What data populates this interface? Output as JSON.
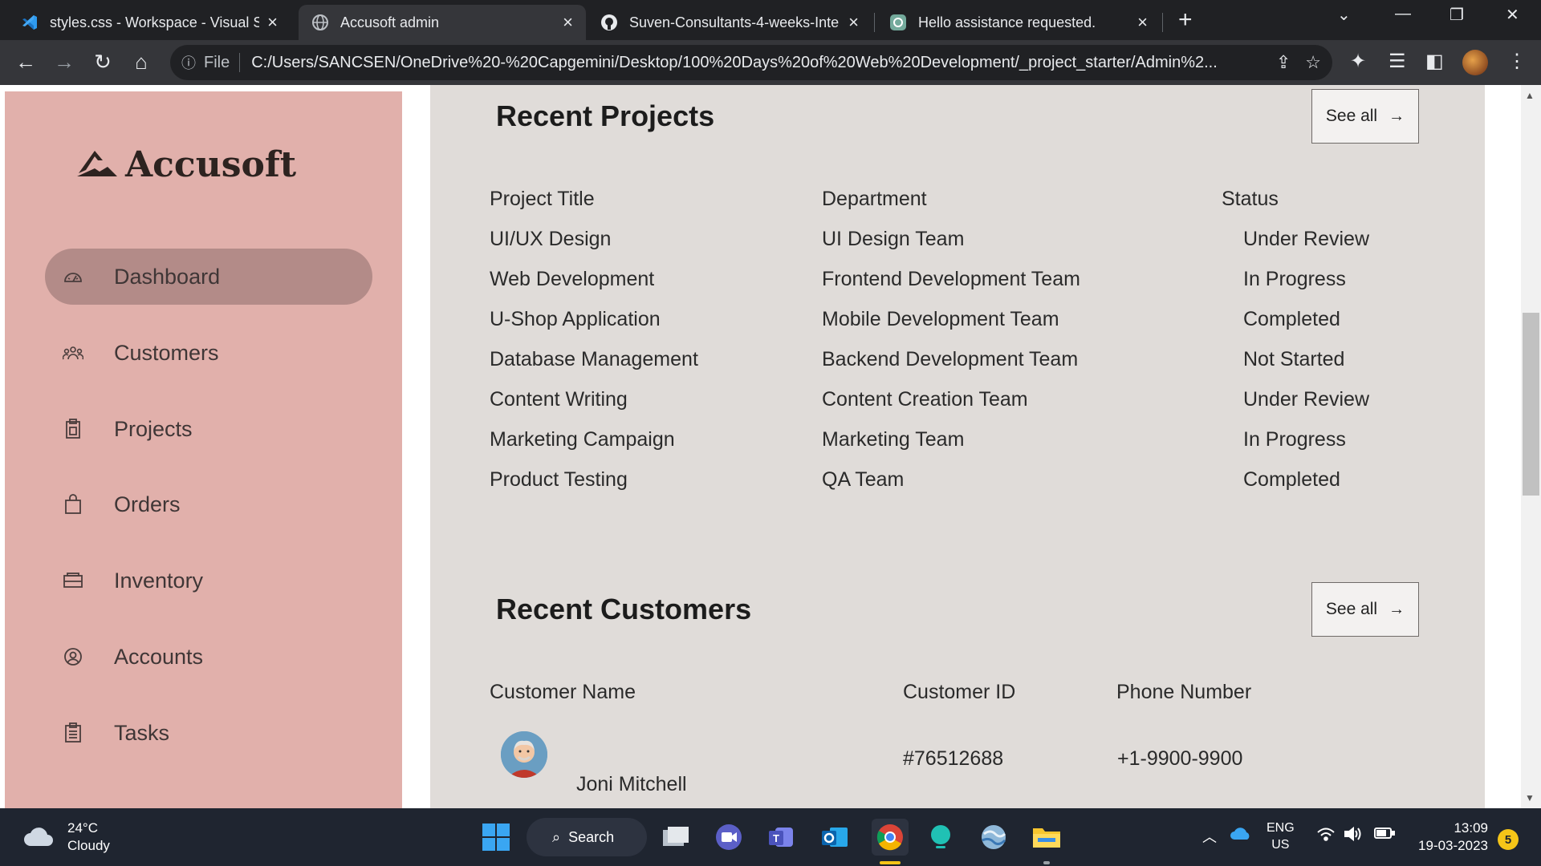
{
  "browser": {
    "tabs": [
      {
        "title": "styles.css - Workspace - Visual St",
        "icon": "vscode-icon"
      },
      {
        "title": "Accusoft admin",
        "icon": "globe-icon"
      },
      {
        "title": "Suven-Consultants-4-weeks-Inte",
        "icon": "github-icon"
      },
      {
        "title": "Hello assistance requested.",
        "icon": "chatgpt-icon"
      }
    ],
    "omnibox": {
      "scheme_label": "File",
      "url": "C:/Users/SANCSEN/OneDrive%20-%20Capgemini/Desktop/100%20Days%20of%20Web%20Development/_project_starter/Admin%2..."
    }
  },
  "sidebar": {
    "logo_text": "Accusoft",
    "items": [
      {
        "label": "Dashboard",
        "icon": "dashboard-icon",
        "active": true
      },
      {
        "label": "Customers",
        "icon": "customers-icon"
      },
      {
        "label": "Projects",
        "icon": "projects-icon"
      },
      {
        "label": "Orders",
        "icon": "orders-icon"
      },
      {
        "label": "Inventory",
        "icon": "inventory-icon"
      },
      {
        "label": "Accounts",
        "icon": "accounts-icon"
      },
      {
        "label": "Tasks",
        "icon": "tasks-icon"
      }
    ]
  },
  "projects": {
    "title": "Recent Projects",
    "see_all": "See all",
    "headers": [
      "Project Title",
      "Department",
      "Status"
    ],
    "rows": [
      [
        "UI/UX Design",
        "UI Design Team",
        "Under Review"
      ],
      [
        "Web Development",
        "Frontend Development Team",
        "In Progress"
      ],
      [
        "U-Shop Application",
        "Mobile Development Team",
        "Completed"
      ],
      [
        "Database Management",
        "Backend Development Team",
        "Not Started"
      ],
      [
        "Content Writing",
        "Content Creation Team",
        "Under Review"
      ],
      [
        "Marketing Campaign",
        "Marketing Team",
        "In Progress"
      ],
      [
        "Product Testing",
        "QA Team",
        "Completed"
      ]
    ]
  },
  "customers": {
    "title": "Recent Customers",
    "see_all": "See all",
    "headers": [
      "Customer Name",
      "Customer ID",
      "Phone Number"
    ],
    "rows": [
      {
        "name": "Joni Mitchell",
        "id": "#76512688",
        "phone": "+1-9900-9900"
      }
    ]
  },
  "taskbar": {
    "weather_temp": "24°C",
    "weather_desc": "Cloudy",
    "search_label": "Search",
    "lang_top": "ENG",
    "lang_bottom": "US",
    "time": "13:09",
    "date": "19-03-2023",
    "notification_count": "5"
  },
  "colors": {
    "sidebar_bg": "#e1b0ab",
    "sidebar_active": "#b38b88",
    "main_bg": "#e0dcd9",
    "taskbar_bg": "#1f2530"
  }
}
